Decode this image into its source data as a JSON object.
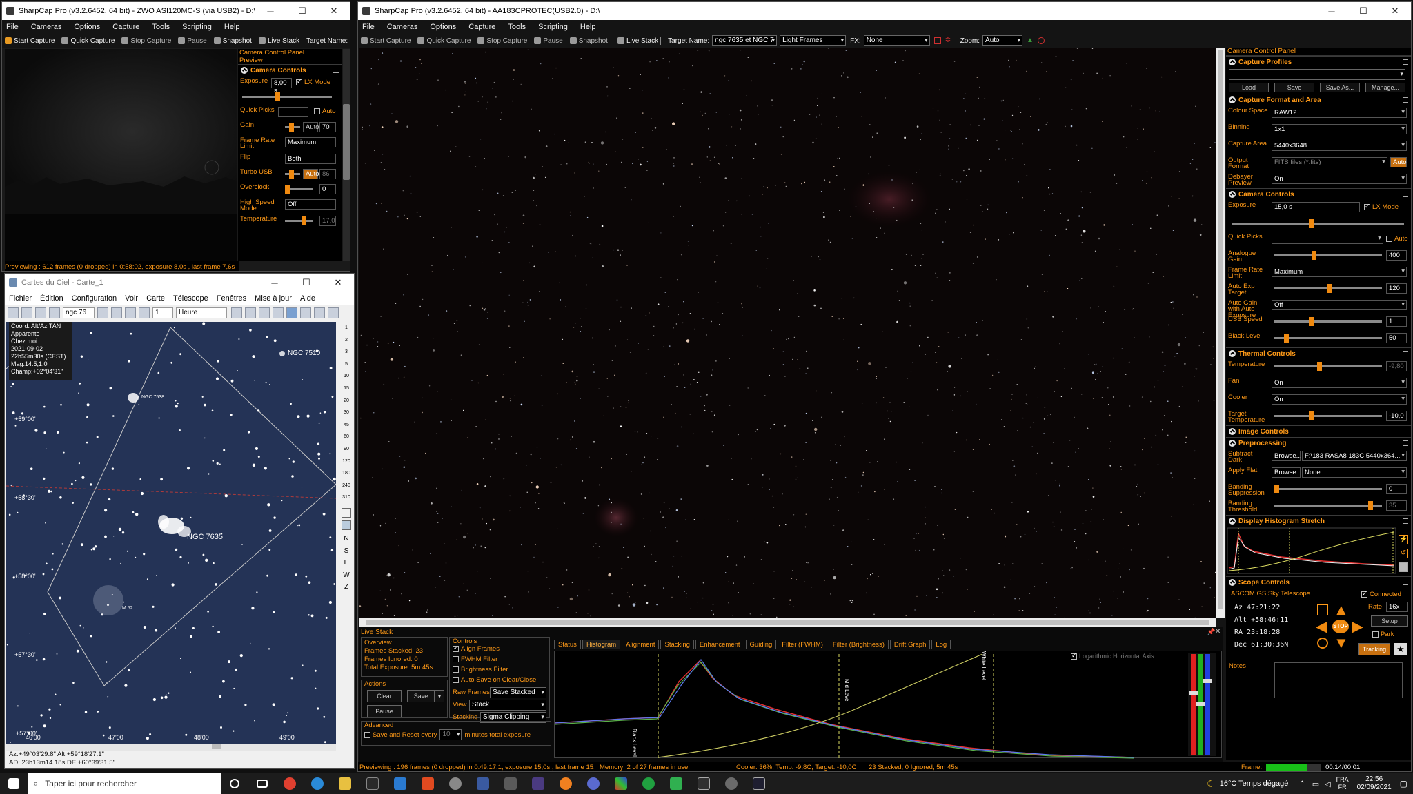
{
  "win_left": {
    "title": "SharpCap Pro (v3.2.6452, 64 bit) - ZWO ASI120MC-S (via USB2) - D:\\",
    "menu": [
      "File",
      "Cameras",
      "Options",
      "Capture",
      "Tools",
      "Scripting",
      "Help"
    ],
    "toolbar": [
      "Start Capture",
      "Quick Capture",
      "Stop Capture",
      "Pause",
      "Snapshot",
      "Live Stack",
      "Target Name:"
    ],
    "panel_title": "Camera Control Panel",
    "preview_label": "Preview",
    "camera_controls_title": "Camera Controls",
    "exposure_label": "Exposure",
    "exposure_value": "8,00 s",
    "lx_mode": "LX Mode",
    "quick_picks": "Quick Picks",
    "auto": "Auto",
    "gain_label": "Gain",
    "gain_value": "70",
    "frame_rate_label": "Frame Rate Limit",
    "frame_rate_value": "Maximum",
    "flip_label": "Flip",
    "flip_value": "Both",
    "turbo_label": "Turbo USB",
    "turbo_value": "86",
    "overclock_label": "Overclock",
    "overclock_value": "0",
    "hsm_label": "High Speed Mode",
    "hsm_value": "Off",
    "temp_label": "Temperature",
    "temp_value": "17,0",
    "status": "Previewing : 612 frames (0 dropped) in 0:58:02, exposure 8,0s , last frame 7,6s"
  },
  "win_cdc": {
    "title": "Cartes du Ciel - Carte_1",
    "menu": [
      "Fichier",
      "Édition",
      "Configuration",
      "Voir",
      "Carte",
      "Télescope",
      "Fenêtres",
      "Mise à jour",
      "Aide"
    ],
    "search_value": "ngc 76",
    "step_value": "1",
    "unit_value": "Heure",
    "info": [
      "Coord. Alt/Az TAN",
      "Apparente",
      "Chez moi",
      "2021-09-02",
      "22h55m30s (CEST)",
      "Mag:14.5,1.0'",
      "Champ:+02°04'31\""
    ],
    "labels": {
      "ngc7510": "NGC 7510",
      "ngc7538": "NGC 7538",
      "ngc7635": "NGC 7635",
      "m52": "M 52"
    },
    "dec_labels": [
      "+59°00'",
      "+58°30'",
      "+58°00'",
      "+57°30'",
      "+57°00'"
    ],
    "ra_labels": [
      "46'00",
      "47'00",
      "48'00",
      "49'00"
    ],
    "zoom_ticks": [
      "1",
      "2",
      "3",
      "5",
      "10",
      "15",
      "20",
      "30",
      "45",
      "60",
      "90",
      "120",
      "180",
      "240",
      "310"
    ],
    "side_letters": [
      "N",
      "S",
      "E",
      "W",
      "Z"
    ],
    "coords_line1": "Az:+49°03'29.8\" Alt:+59°18'27.1\"",
    "coords_line2": "AD: 23h13m14.18s DE:+60°39'31.5\""
  },
  "win_main": {
    "title": "SharpCap Pro (v3.2.6452, 64 bit) - AA183CPROTEC(USB2.0) - D:\\",
    "menu": [
      "File",
      "Cameras",
      "Options",
      "Capture",
      "Tools",
      "Scripting",
      "Help"
    ],
    "toolbar": [
      "Start Capture",
      "Quick Capture",
      "Stop Capture",
      "Pause",
      "Snapshot",
      "Live Stack"
    ],
    "target_label": "Target Name:",
    "target_value": "ngc 7635 et NGC 7",
    "frame_type": "Light Frames",
    "fx_label": "FX:",
    "fx_value": "None",
    "zoom_label": "Zoom:",
    "zoom_value": "Auto",
    "status": "Previewing : 196 frames (0 dropped) in 0:49:17,1, exposure 15,0s , last frame 15,0s",
    "memory": "Memory: 2 of 27 frames in use.",
    "cooler": "Cooler: 36%, Temp: -9,8C, Target: -10,0C",
    "stacked_status": "23 Stacked, 0 Ignored, 5m 45s",
    "frame_label": "Frame:",
    "frame_time": "00:14/00:01",
    "frame_progress": 0.75
  },
  "livestack": {
    "title": "Live Stack",
    "overview": "Overview",
    "frames_stacked": "Frames Stacked: 23",
    "frames_ignored": "Frames Ignored:  0",
    "total_exposure": "Total Exposure:   5m 45s",
    "actions": "Actions",
    "clear": "Clear",
    "save": "Save",
    "pause": "Pause",
    "controls": "Controls",
    "align": "Align Frames",
    "fwhm": "FWHM Filter",
    "brightness": "Brightness Filter",
    "autosave": "Auto Save on Clear/Close",
    "raw_frames_label": "Raw Frames",
    "raw_frames_value": "Save Stacked",
    "view_label": "View",
    "view_value": "Stack",
    "stacking_label": "Stacking",
    "stacking_value": "Sigma Clipping",
    "advanced": "Advanced",
    "save_reset": "Save and Reset every",
    "save_reset_value": "10",
    "minutes_total": "minutes total exposure",
    "tabs": [
      "Status",
      "Histogram",
      "Alignment",
      "Stacking",
      "Enhancement",
      "Guiding",
      "Filter (FWHM)",
      "Filter (Brightness)",
      "Drift Graph",
      "Log"
    ],
    "log_axis": "Logarithmic Horizontal Axis",
    "black_level": "Black Level",
    "mid_level": "Mid Level",
    "white_level": "White Level"
  },
  "ccp": {
    "title": "Camera Control Panel",
    "profiles_title": "Capture Profiles",
    "profile_buttons": [
      "Load",
      "Save",
      "Save As...",
      "Manage..."
    ],
    "format_title": "Capture Format and Area",
    "colour_space_label": "Colour Space",
    "colour_space_value": "RAW12",
    "binning_label": "Binning",
    "binning_value": "1x1",
    "capture_area_label": "Capture Area",
    "capture_area_value": "5440x3648",
    "output_format_label": "Output Format",
    "output_format_value": "FITS files (*.fits)",
    "auto": "Auto",
    "debayer_label": "Debayer Preview",
    "debayer_value": "On",
    "camera_controls_title": "Camera Controls",
    "exposure_label": "Exposure",
    "exposure_value": "15,0 s",
    "lx_mode": "LX Mode",
    "quick_picks_label": "Quick Picks",
    "analogue_gain_label": "Analogue Gain",
    "analogue_gain_value": "400",
    "frame_rate_label": "Frame Rate Limit",
    "frame_rate_value": "Maximum",
    "auto_exp_label": "Auto Exp Target",
    "auto_exp_value": "120",
    "auto_gain_label": "Auto Gain with Auto Exposure",
    "auto_gain_value": "Off",
    "usb_speed_label": "USB Speed",
    "usb_speed_value": "1",
    "black_level_label": "Black Level",
    "black_level_value": "50",
    "thermal_title": "Thermal Controls",
    "temperature_label": "Temperature",
    "temperature_value": "-9,80",
    "fan_label": "Fan",
    "fan_value": "On",
    "cooler_label": "Cooler",
    "cooler_value": "On",
    "target_temp_label": "Target Temperature",
    "target_temp_value": "-10,0",
    "image_controls_title": "Image Controls",
    "preprocessing_title": "Preprocessing",
    "subtract_dark_label": "Subtract Dark",
    "browse": "Browse...",
    "subtract_dark_value": "F:\\183 RASA8 183C 5440x364...",
    "apply_flat_label": "Apply Flat",
    "apply_flat_value": "None",
    "banding_supp_label": "Banding Suppression",
    "banding_supp_value": "0",
    "banding_thresh_label": "Banding Threshold",
    "banding_thresh_value": "35",
    "histogram_title": "Display Histogram Stretch",
    "scope_title": "Scope Controls",
    "scope_name": "ASCOM GS Sky Telescope",
    "connected": "Connected",
    "az": "Az   47:21:22",
    "alt": "Alt  +58:46:11",
    "ra": "RA   23:18:28",
    "dec": "Dec  61:30:36N",
    "rate_label": "Rate:",
    "rate_value": "16x",
    "setup": "Setup",
    "park": "Park",
    "tracking": "Tracking",
    "stop": "STOP",
    "notes": "Notes"
  },
  "taskbar": {
    "search_placeholder": "Taper ici pour rechercher",
    "weather": "16°C  Temps dégagé",
    "lang1": "FRA",
    "lang2": "FR",
    "time": "22:56",
    "date": "02/09/2021"
  },
  "colors": {
    "accent": "#ff9a18",
    "sky": "#0b0606",
    "map": "#243356"
  }
}
